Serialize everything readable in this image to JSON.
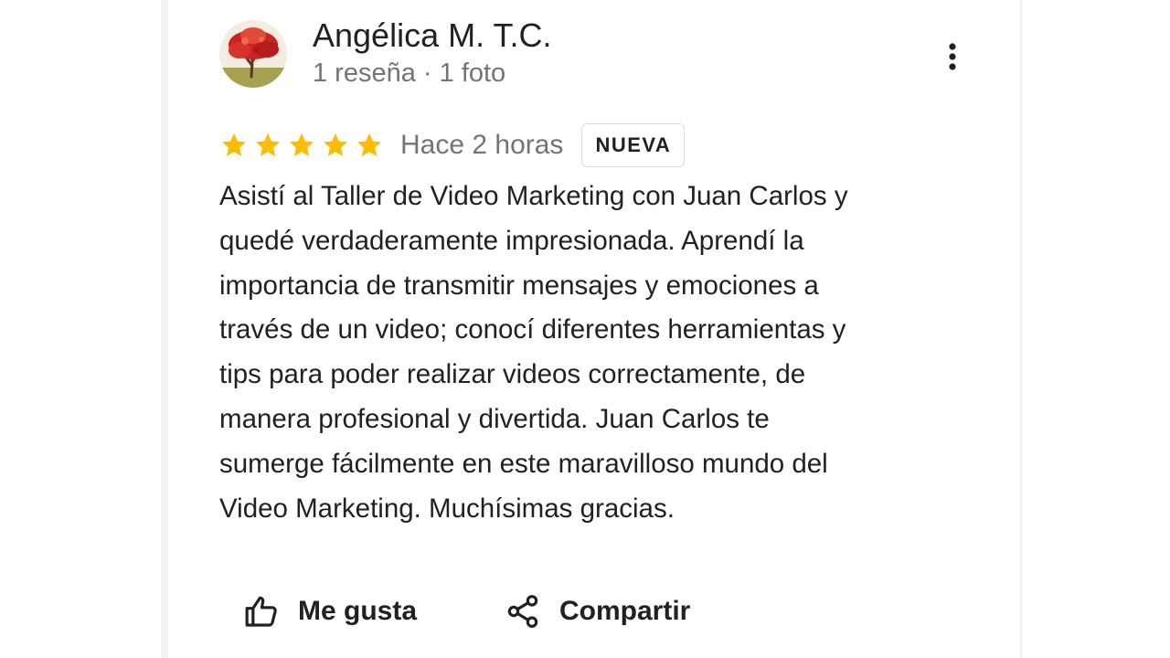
{
  "reviewer": {
    "name": "Angélica M. T.C.",
    "meta": "1 reseña · 1 foto",
    "avatar_icon": "tree-avatar"
  },
  "menu": {
    "icon": "more-vert-icon"
  },
  "review": {
    "rating": 5,
    "rating_max": 5,
    "star_color": "#fbbc04",
    "date": "Hace 2 horas",
    "badge": "NUEVA",
    "text_lines": [
      "Asistí al Taller de Video Marketing con Juan Carlos y",
      "quedé verdaderamente impresionada. Aprendí la",
      "importancia de transmitir mensajes y emociones a",
      "través de un video; conocí diferentes herramientas y",
      "tips para poder realizar videos correctamente, de",
      "manera profesional y divertida. Juan Carlos te",
      "sumerge fácilmente en este maravilloso mundo del",
      "Video Marketing. Muchísimas gracias."
    ]
  },
  "actions": {
    "like_label": "Me gusta",
    "like_icon": "thumb-up-icon",
    "share_label": "Compartir",
    "share_icon": "share-icon"
  }
}
